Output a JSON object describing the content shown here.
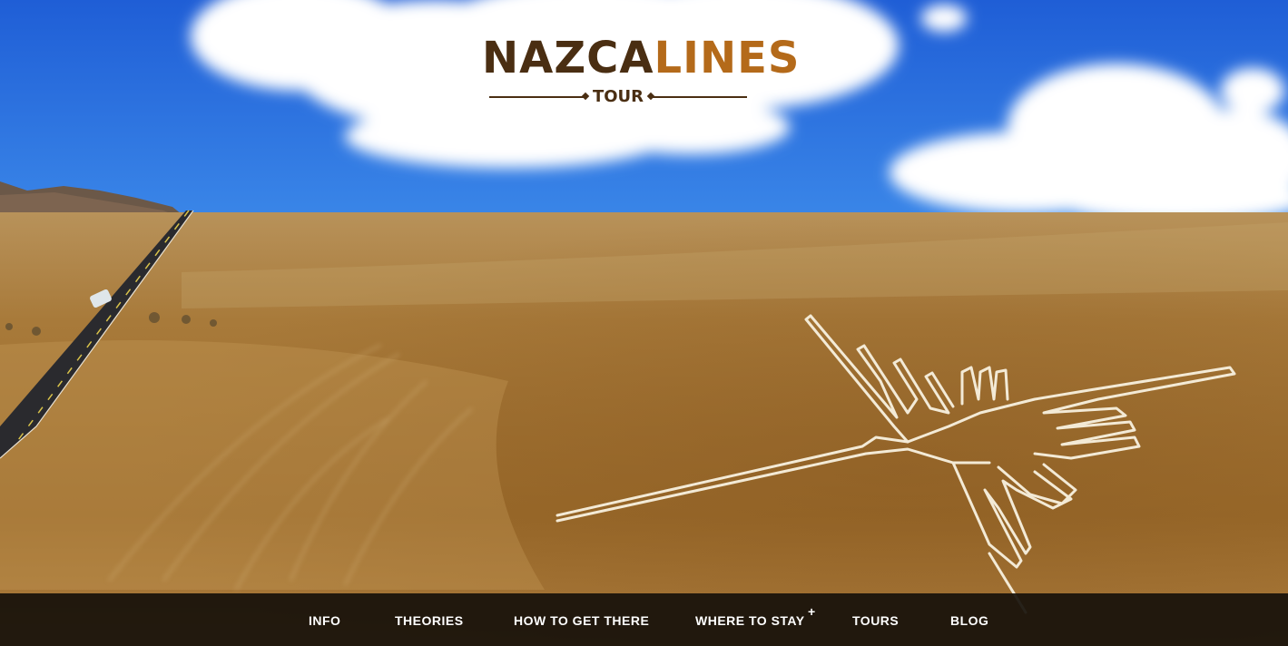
{
  "logo": {
    "word1": "NAZCA",
    "word2": "LINES",
    "sub": "TOUR",
    "colors": {
      "dark": "#4a2e12",
      "accent": "#b46a1a"
    }
  },
  "hero": {
    "icon": "nazca-hummingbird-geoglyph"
  },
  "nav": {
    "items": [
      {
        "label": "INFO"
      },
      {
        "label": "THEORIES"
      },
      {
        "label": "HOW TO GET THERE"
      },
      {
        "label": "WHERE TO STAY",
        "submenu_indicator": "+"
      },
      {
        "label": "TOURS"
      },
      {
        "label": "BLOG"
      }
    ]
  }
}
